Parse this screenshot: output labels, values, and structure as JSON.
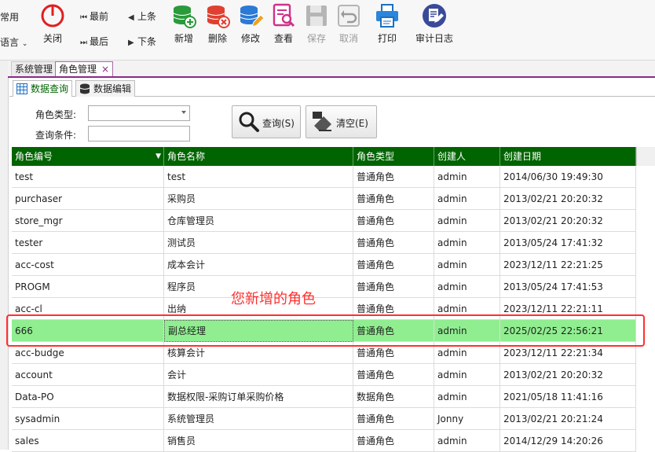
{
  "toolbar": {
    "left_top": "常用",
    "left_bottom": "语言",
    "close": "关闭",
    "nav_first": "最前",
    "nav_last": "最后",
    "nav_prev": "上条",
    "nav_next": "下条",
    "add": "新增",
    "delete": "删除",
    "edit": "修改",
    "view": "查看",
    "save": "保存",
    "cancel": "取消",
    "print": "打印",
    "audit_log": "审计日志"
  },
  "tabs": {
    "system": "系统管理",
    "role": "角色管理",
    "close": "×"
  },
  "subtabs": {
    "query": "数据查询",
    "edit": "数据编辑"
  },
  "form": {
    "role_type_label": "角色类型:",
    "role_type_value": "",
    "condition_label": "查询条件:",
    "condition_value": "",
    "query_button": "查询(S)",
    "clear_button": "清空(E)"
  },
  "grid": {
    "columns": [
      "角色编号",
      "角色名称",
      "角色类型",
      "创建人",
      "创建日期"
    ],
    "rows": [
      [
        "test",
        "test",
        "普通角色",
        "admin",
        "2014/06/30 19:49:30"
      ],
      [
        "purchaser",
        "采购员",
        "普通角色",
        "admin",
        "2013/02/21 20:20:32"
      ],
      [
        "store_mgr",
        "仓库管理员",
        "普通角色",
        "admin",
        "2013/02/21 20:20:32"
      ],
      [
        "tester",
        "测试员",
        "普通角色",
        "admin",
        "2013/05/24 17:41:32"
      ],
      [
        "acc-cost",
        "成本会计",
        "普通角色",
        "admin",
        "2023/12/11 22:21:25"
      ],
      [
        "PROGM",
        "程序员",
        "普通角色",
        "admin",
        "2013/05/24 17:41:53"
      ],
      [
        "acc-cl",
        "出纳",
        "普通角色",
        "admin",
        "2023/12/11 22:21:11"
      ],
      [
        "666",
        "副总经理",
        "普通角色",
        "admin",
        "2025/02/25 22:56:21"
      ],
      [
        "acc-budge",
        "核算会计",
        "普通角色",
        "admin",
        "2023/12/11 22:21:34"
      ],
      [
        "account",
        "会计",
        "普通角色",
        "admin",
        "2013/02/21 20:20:32"
      ],
      [
        "Data-PO",
        "数据权限-采购订单采购价格",
        "数据角色",
        "admin",
        "2021/05/18 11:41:16"
      ],
      [
        "sysadmin",
        "系统管理员",
        "普通角色",
        "Jonny",
        "2013/02/21 20:21:24"
      ],
      [
        "sales",
        "销售员",
        "普通角色",
        "admin",
        "2014/12/29 14:20:26"
      ]
    ]
  },
  "annotation": "您新增的角色",
  "colors": {
    "header_green": "#006400",
    "highlight_row": "#90ee90",
    "annotation_red": "#ff3030"
  }
}
